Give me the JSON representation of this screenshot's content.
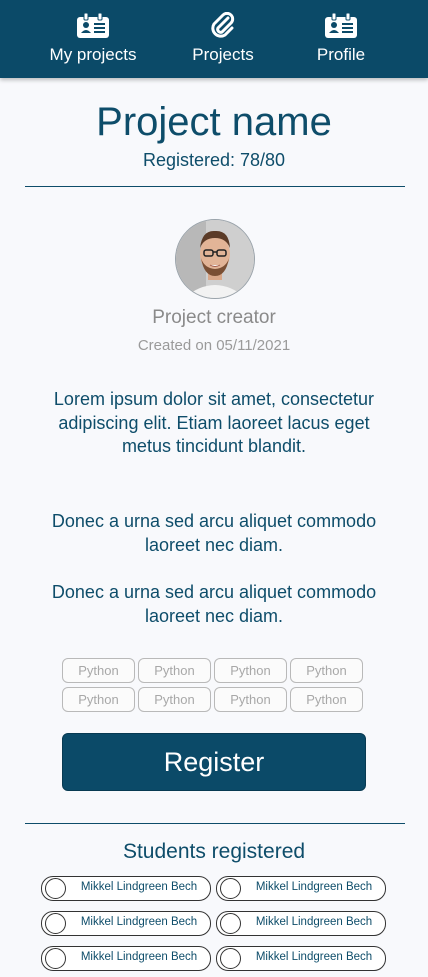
{
  "nav": {
    "items": [
      {
        "label": "My projects",
        "icon": "id-card-icon"
      },
      {
        "label": "Projects",
        "icon": "paperclip-icon"
      },
      {
        "label": "Profile",
        "icon": "id-card-icon"
      }
    ]
  },
  "project": {
    "title": "Project name",
    "registered": "Registered: 78/80",
    "creator": "Project creator",
    "created_on": "Created on 05/11/2021",
    "paragraphs": [
      "Lorem ipsum dolor sit amet, consectetur adipiscing elit. Etiam laoreet lacus eget metus tincidunt blandit.",
      "Donec a urna sed arcu aliquet commodo laoreet nec diam.",
      "Donec a urna sed arcu aliquet commodo laoreet nec diam."
    ],
    "tags": [
      "Python",
      "Python",
      "Python",
      "Python",
      "Python",
      "Python",
      "Python",
      "Python"
    ],
    "register_label": "Register"
  },
  "students": {
    "title": "Students registered",
    "list": [
      "Mikkel Lindgreen Bech",
      "Mikkel Lindgreen Bech",
      "Mikkel Lindgreen Bech",
      "Mikkel Lindgreen Bech",
      "Mikkel Lindgreen Bech",
      "Mikkel Lindgreen Bech"
    ]
  },
  "colors": {
    "primary": "#0b4a68",
    "text": "#0e4d6a",
    "background": "#f8f9fc"
  }
}
